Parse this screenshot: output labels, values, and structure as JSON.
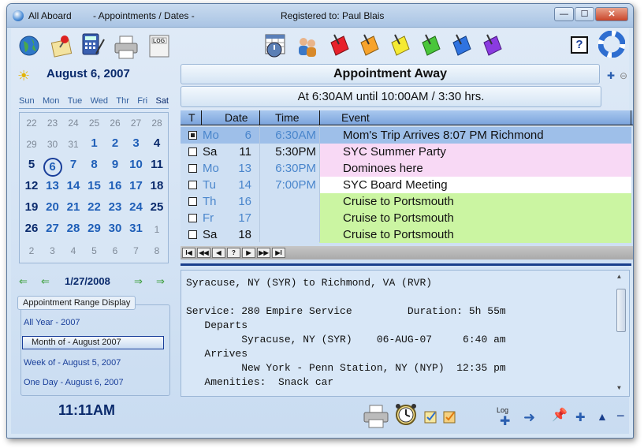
{
  "window": {
    "app_title": "All Aboard",
    "section_title": "- Appointments / Dates -",
    "registered": "Registered to: Paul Blais",
    "min_label": "—",
    "max_label": "☐",
    "close_label": "✕"
  },
  "colors": {
    "accent": "#0a2a6c",
    "link_blue": "#1f5fb8",
    "selected_row": "#9ebfe9",
    "pink_event": "#f8d9f5",
    "green_event": "#cbf5a2",
    "white_event": "#ffffff"
  },
  "toolbar": {
    "left_icons": [
      "globe-icon",
      "notepad-pin-icon",
      "calculator-icon",
      "printer-icon",
      "log-icon"
    ],
    "log_label": "LOG",
    "center_icons": [
      "calendar-clock-icon",
      "people-icon",
      "red-note-icon",
      "orange-note-icon",
      "yellow-note-icon",
      "green-note-icon",
      "blue-note-icon",
      "purple-note-icon"
    ],
    "right_icons": [
      "help-icon",
      "life-ring-icon"
    ],
    "help_label": "?"
  },
  "calendar": {
    "current_date": "August 6, 2007",
    "weekdays": [
      "Sun",
      "Mon",
      "Tue",
      "Wed",
      "Thr",
      "Fri",
      "Sat"
    ],
    "weeks": [
      [
        {
          "d": "22",
          "o": true
        },
        {
          "d": "23",
          "o": true
        },
        {
          "d": "24",
          "o": true
        },
        {
          "d": "25",
          "o": true
        },
        {
          "d": "26",
          "o": true
        },
        {
          "d": "27",
          "o": true
        },
        {
          "d": "28",
          "o": true
        }
      ],
      [
        {
          "d": "29",
          "o": true
        },
        {
          "d": "30",
          "o": true
        },
        {
          "d": "31",
          "o": true
        },
        {
          "d": "1"
        },
        {
          "d": "2"
        },
        {
          "d": "3"
        },
        {
          "d": "4",
          "w": true
        }
      ],
      [
        {
          "d": "5",
          "w": true
        },
        {
          "d": "6",
          "s": true
        },
        {
          "d": "7"
        },
        {
          "d": "8"
        },
        {
          "d": "9"
        },
        {
          "d": "10"
        },
        {
          "d": "11",
          "w": true
        }
      ],
      [
        {
          "d": "12",
          "w": true
        },
        {
          "d": "13"
        },
        {
          "d": "14"
        },
        {
          "d": "15"
        },
        {
          "d": "16"
        },
        {
          "d": "17"
        },
        {
          "d": "18",
          "w": true
        }
      ],
      [
        {
          "d": "19",
          "w": true
        },
        {
          "d": "20"
        },
        {
          "d": "21"
        },
        {
          "d": "22"
        },
        {
          "d": "23"
        },
        {
          "d": "24"
        },
        {
          "d": "25",
          "w": true
        }
      ],
      [
        {
          "d": "26",
          "w": true
        },
        {
          "d": "27"
        },
        {
          "d": "28"
        },
        {
          "d": "29"
        },
        {
          "d": "30"
        },
        {
          "d": "31"
        },
        {
          "d": "1",
          "o": true
        }
      ],
      [
        {
          "d": "2",
          "o": true
        },
        {
          "d": "3",
          "o": true
        },
        {
          "d": "4",
          "o": true
        },
        {
          "d": "5",
          "o": true
        },
        {
          "d": "6",
          "o": true
        },
        {
          "d": "7",
          "o": true
        },
        {
          "d": "8",
          "o": true
        }
      ]
    ],
    "nav_date": "1/27/2008",
    "nav_arrows": [
      "⇐",
      "⇐",
      "⇒",
      "⇒"
    ]
  },
  "range": {
    "title": "Appointment Range Display",
    "items": [
      "All Year  - 2007",
      "Month of - August 2007",
      "Week of  - August  5, 2007",
      "One Day - August  6, 2007"
    ],
    "active_index": 1
  },
  "clock": "11:11AM",
  "appointment": {
    "title": "Appointment Away",
    "time_line": "At 6:30AM  until 10:00AM / 3:30 hrs."
  },
  "grid": {
    "headers": [
      "T",
      "Date",
      "Time",
      "Event"
    ],
    "rows": [
      {
        "checked": true,
        "day": "Mo",
        "date": "6",
        "time": "6:30AM",
        "event": "Mom's Trip Arrives 8:07 PM Richmond",
        "bg": "#9ebfe9",
        "muted": true
      },
      {
        "checked": false,
        "day": "Sa",
        "date": "11",
        "time": "5:30PM",
        "event": "SYC Summer Party",
        "bg": "#f8d9f5",
        "muted": false
      },
      {
        "checked": false,
        "day": "Mo",
        "date": "13",
        "time": "6:30PM",
        "event": "Dominoes here",
        "bg": "#f8d9f5",
        "muted": true
      },
      {
        "checked": false,
        "day": "Tu",
        "date": "14",
        "time": "7:00PM",
        "event": "SYC Board Meeting",
        "bg": "#ffffff",
        "muted": true
      },
      {
        "checked": false,
        "day": "Th",
        "date": "16",
        "time": "",
        "event": "Cruise to Portsmouth",
        "bg": "#cbf5a2",
        "muted": true
      },
      {
        "checked": false,
        "day": "Fr",
        "date": "17",
        "time": "",
        "event": "Cruise to Portsmouth",
        "bg": "#cbf5a2",
        "muted": true
      },
      {
        "checked": false,
        "day": "Sa",
        "date": "18",
        "time": "",
        "event": "Cruise to Portsmouth",
        "bg": "#cbf5a2",
        "muted": false
      }
    ],
    "nav_buttons": [
      "I◀",
      "◀◀",
      "◀",
      "?",
      "▶",
      "▶▶",
      "▶I"
    ]
  },
  "memo": {
    "lines": [
      "Syracuse, NY (SYR) to Richmond, VA (RVR)",
      "",
      "Service: 280 Empire Service         Duration: 5h 55m",
      "   Departs",
      "         Syracuse, NY (SYR)    06-AUG-07     6:40 am",
      "   Arrives",
      "         New York - Penn Station, NY (NYP)  12:35 pm",
      "   Amenities:  Snack car"
    ]
  },
  "bottom_toolbar": {
    "log_label": "Log",
    "icons": [
      "printer-icon",
      "alarm-clock-icon",
      "checklist-icon",
      "checklist-alt-icon",
      "log-add-icon",
      "arrow-right-icon",
      "pin-icon",
      "plus-icon",
      "up-triangle-icon",
      "minus-icon"
    ]
  }
}
